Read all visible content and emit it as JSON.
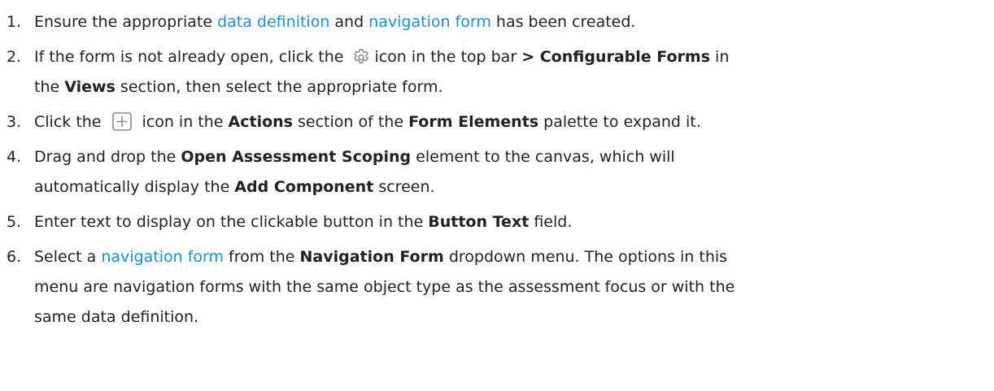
{
  "steps": [
    {
      "num": "1.",
      "t1": "Ensure the appropriate ",
      "link1": "data definition",
      "t2": " and ",
      "link2": "navigation form",
      "t3": " has been created."
    },
    {
      "num": "2.",
      "t1": "If the form is not already open, click the",
      "icon": "gear-icon",
      "t2": "icon in the top bar ",
      "b1": "> Configurable Forms",
      "t3": " in",
      "t4": "the ",
      "b2": "Views",
      "t5": " section, then select the appropriate form."
    },
    {
      "num": "3.",
      "t1": "Click the",
      "icon": "plus-box-icon",
      "t2": "icon in the ",
      "b1": "Actions",
      "t3": " section of the ",
      "b2": "Form Elements",
      "t4": " palette to expand it."
    },
    {
      "num": "4.",
      "t1": "Drag and drop the ",
      "b1": "Open Assessment Scoping",
      "t2": " element to the canvas, which will",
      "t3": "automatically display the ",
      "b2": "Add Component",
      "t4": " screen."
    },
    {
      "num": "5.",
      "t1": "Enter text to display on the clickable button in the ",
      "b1": "Button Text",
      "t2": " field."
    },
    {
      "num": "6.",
      "t1": "Select a ",
      "link1": "navigation form",
      "t2": " from the ",
      "b1": "Navigation Form",
      "t3": " dropdown menu. The options in this",
      "t4": "menu are navigation forms with the same object type as the assessment focus or with the",
      "t5": "same data definition."
    }
  ],
  "colors": {
    "link": "#1a8fc9",
    "text": "#222222",
    "icon": "#8a8a8a"
  }
}
